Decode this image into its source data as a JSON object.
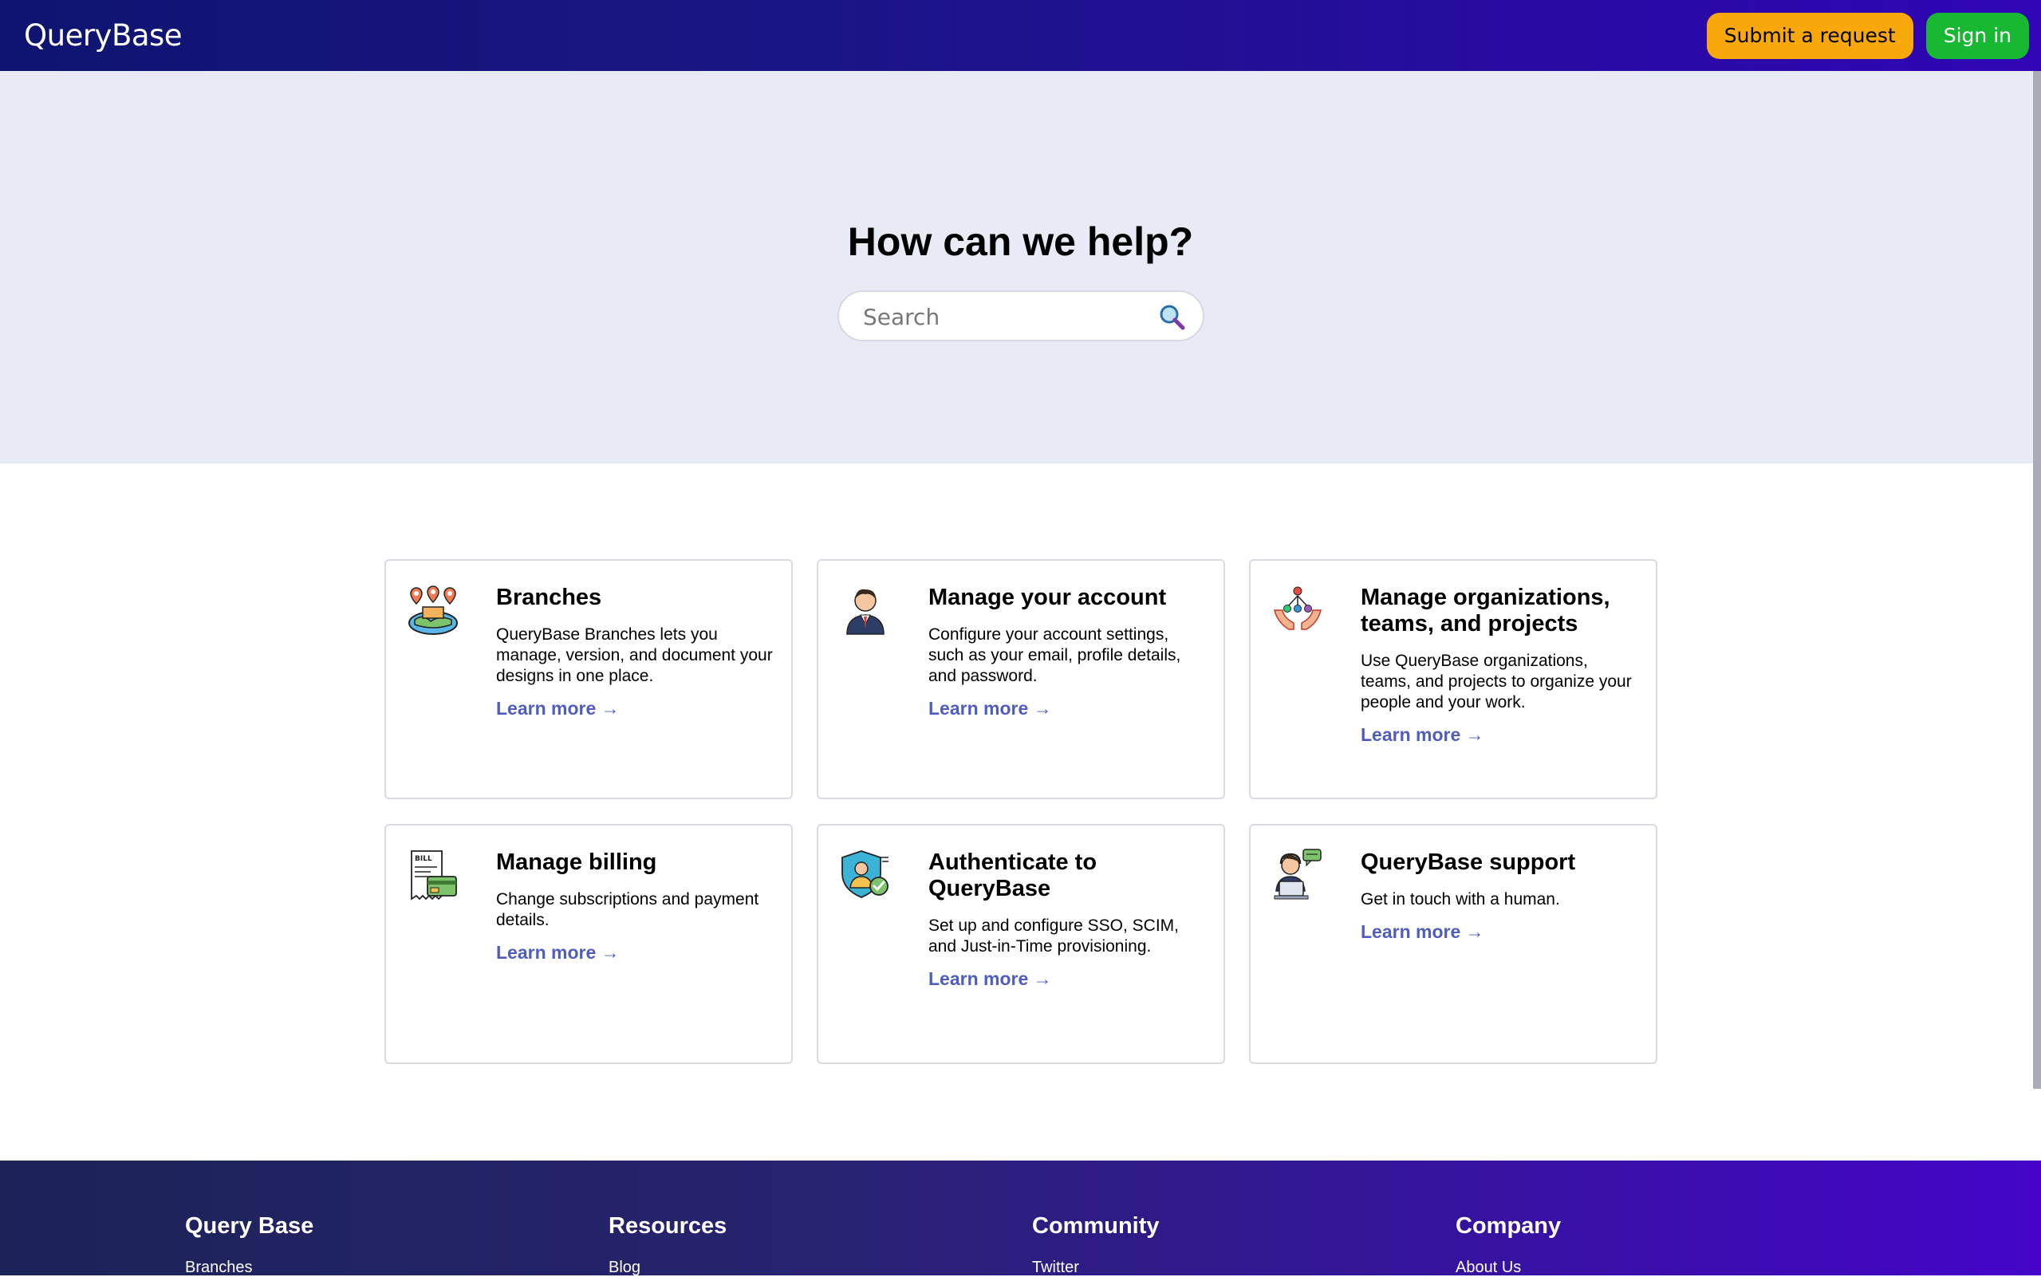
{
  "header": {
    "logo": "QueryBase",
    "submit_label": "Submit a request",
    "signin_label": "Sign in"
  },
  "hero": {
    "title": "How can we help?",
    "search_placeholder": "Search"
  },
  "cards": [
    {
      "title": "Branches",
      "description": "QueryBase Branches lets you manage, version, and document your designs in one place.",
      "link": "Learn more →",
      "icon": "map-pins-icon"
    },
    {
      "title": "Manage your account",
      "description": "Configure your account settings, such as your email, profile details, and password.",
      "link": "Learn more →",
      "icon": "user-account-icon"
    },
    {
      "title": "Manage organizations, teams, and projects",
      "description": "Use QueryBase organizations, teams, and projects to organize your people and your work.",
      "link": "Learn more →",
      "icon": "organization-hands-icon"
    },
    {
      "title": "Manage billing",
      "description": "Change subscriptions and payment details.",
      "link": "Learn more →",
      "icon": "bill-card-icon"
    },
    {
      "title": "Authenticate to QueryBase",
      "description": "Set up and configure SSO, SCIM, and Just-in-Time provisioning.",
      "link": "Learn more →",
      "icon": "shield-user-icon"
    },
    {
      "title": "QueryBase support",
      "description": "Get in touch with a human.",
      "link": "Learn more →",
      "icon": "support-agent-icon"
    }
  ],
  "footer": {
    "columns": [
      {
        "title": "Query Base",
        "first_link": "Branches"
      },
      {
        "title": "Resources",
        "first_link": "Blog"
      },
      {
        "title": "Community",
        "first_link": "Twitter"
      },
      {
        "title": "Company",
        "first_link": "About Us"
      }
    ]
  },
  "colors": {
    "accent_orange": "#f9a80c",
    "accent_green": "#19b832",
    "link_blue": "#4f5dbf",
    "hero_bg": "#e8eaf6"
  }
}
